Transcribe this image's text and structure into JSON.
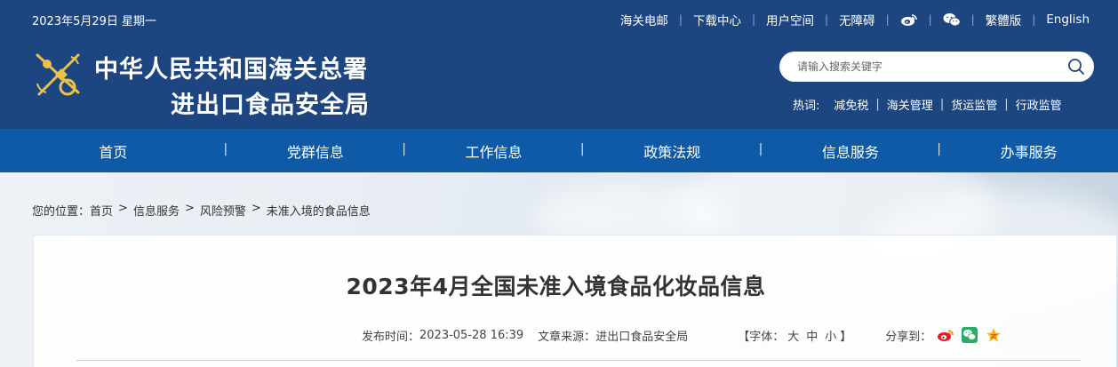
{
  "header": {
    "date": "2023年5月29日 星期一",
    "links": [
      "海关电邮",
      "下载中心",
      "用户空间",
      "无障碍"
    ],
    "icons": [
      "weibo-icon",
      "wechat-icon"
    ],
    "lang_trad": "繁體版",
    "lang_en": "English",
    "title_line1": "中华人民共和国海关总署",
    "title_line2": "进出口食品安全局",
    "search_placeholder": "请输入搜索关键字",
    "hot_label": "热词:",
    "hot_items": [
      "减免税",
      "海关管理",
      "货运监管",
      "行政监管"
    ]
  },
  "nav": {
    "items": [
      "首页",
      "党群信息",
      "工作信息",
      "政策法规",
      "信息服务",
      "办事服务"
    ],
    "separator": "|"
  },
  "breadcrumb": {
    "prefix": "您的位置：",
    "items": [
      "首页",
      "信息服务",
      "风险预警"
    ],
    "current": "未准入境的食品信息",
    "separator": ">"
  },
  "article": {
    "title": "2023年4月全国未准入境食品化妆品信息",
    "publish_label": "发布时间：",
    "publish_time": "2023-05-28 16:39",
    "source_label": "文章来源：",
    "source": "进出口食品安全局",
    "font_open": "【字体：",
    "font_large": "大",
    "font_medium": "中",
    "font_small": "小",
    "font_close": "】",
    "share_label": "分享到：",
    "share_icons": [
      "weibo-icon",
      "wechat-icon",
      "qzone-icon"
    ]
  },
  "colors": {
    "header_bg": "#1d4580",
    "nav_bg": "#0f5aa6",
    "weibo": "#e6162d",
    "wechat": "#2aae67",
    "qzone": "#f6b500"
  }
}
